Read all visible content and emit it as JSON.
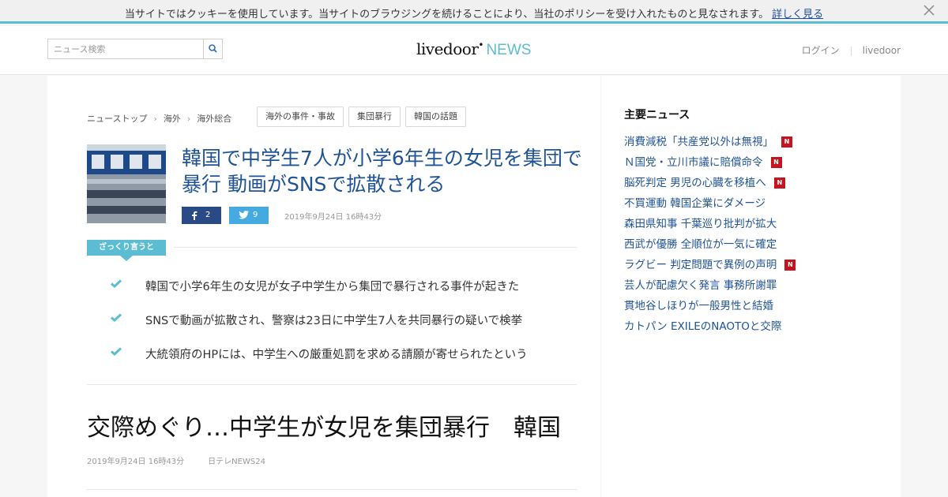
{
  "cookie": {
    "message": "当サイトではクッキーを使用しています。当サイトのブラウジングを続けることにより、当社のポリシーを受け入れたものと見なされます。",
    "link": "詳しく見る"
  },
  "header": {
    "search_placeholder": "ニュース検索",
    "logo_main": "livedoor",
    "logo_sub": "NEWS",
    "login": "ログイン",
    "livedoor": "livedoor"
  },
  "breadcrumb": [
    "ニューストップ",
    "海外",
    "海外総合"
  ],
  "tags": [
    "海外の事件・事故",
    "集団暴行",
    "韓国の話題"
  ],
  "article": {
    "title": "韓国で中学生7人が小学6年生の女児を集団で暴行 動画がSNSで拡散される",
    "fb_count": "2",
    "tw_count": "9",
    "date": "2019年9月24日 16時43分",
    "summary_label": "ざっくり言うと",
    "summary": [
      "韓国で小学6年生の女児が女子中学生から集団で暴行される事件が起きた",
      "SNSで動画が拡散され、警察は23日に中学生7人を共同暴行の疑いで検挙",
      "大統領府のHPには、中学生への厳重処罰を求める請願が寄せられたという"
    ],
    "headline": "交際めぐり…中学生が女児を集団暴行　韓国",
    "source_date": "2019年9月24日 16時43分",
    "source": "日テレNEWS24"
  },
  "sidebar": {
    "heading": "主要ニュース",
    "badge": "N",
    "items": [
      {
        "text": "消費減税「共産党以外は無視」",
        "is_new": true
      },
      {
        "text": "Ｎ国党・立川市議に賠償命令",
        "is_new": true
      },
      {
        "text": "脳死判定 男児の心臓を移植へ",
        "is_new": true
      },
      {
        "text": "不買運動 韓国企業にダメージ",
        "is_new": false
      },
      {
        "text": "森田県知事 千葉巡り批判が拡大",
        "is_new": false
      },
      {
        "text": "西武が優勝 全順位が一気に確定",
        "is_new": false
      },
      {
        "text": "ラグビー 判定問題で異例の声明",
        "is_new": true
      },
      {
        "text": "芸人が配慮欠く発言 事務所謝罪",
        "is_new": false
      },
      {
        "text": "貫地谷しほりが一般男性と結婚",
        "is_new": false
      },
      {
        "text": "カトパン EXILEのNAOTOと交際",
        "is_new": false
      }
    ]
  },
  "colors": {
    "accent": "#5bbcd2",
    "link": "#1f5396",
    "badge": "#c8131f",
    "facebook": "#2a4a85",
    "twitter": "#45aadf"
  }
}
